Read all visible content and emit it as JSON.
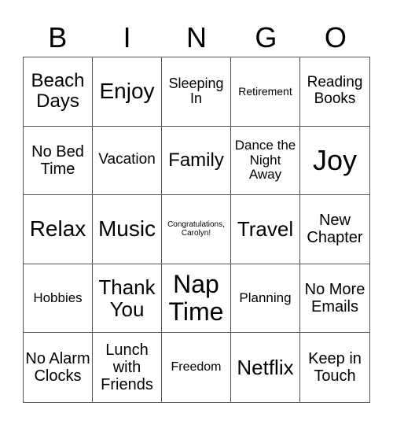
{
  "header": {
    "letters": [
      "B",
      "I",
      "N",
      "G",
      "O"
    ]
  },
  "cells": [
    "Beach Days",
    "Enjoy",
    "Sleeping In",
    "Retirement",
    "Reading Books",
    "No Bed Time",
    "Vacation",
    "Family",
    "Dance the Night Away",
    "Joy",
    "Relax",
    "Music",
    "Congratulations, Carolyn!",
    "Travel",
    "New Chapter",
    "Hobbies",
    "Thank You",
    "Nap Time",
    "Planning",
    "No More Emails",
    "No Alarm Clocks",
    "Lunch with Friends",
    "Freedom",
    "Netflix",
    "Keep in Touch"
  ]
}
